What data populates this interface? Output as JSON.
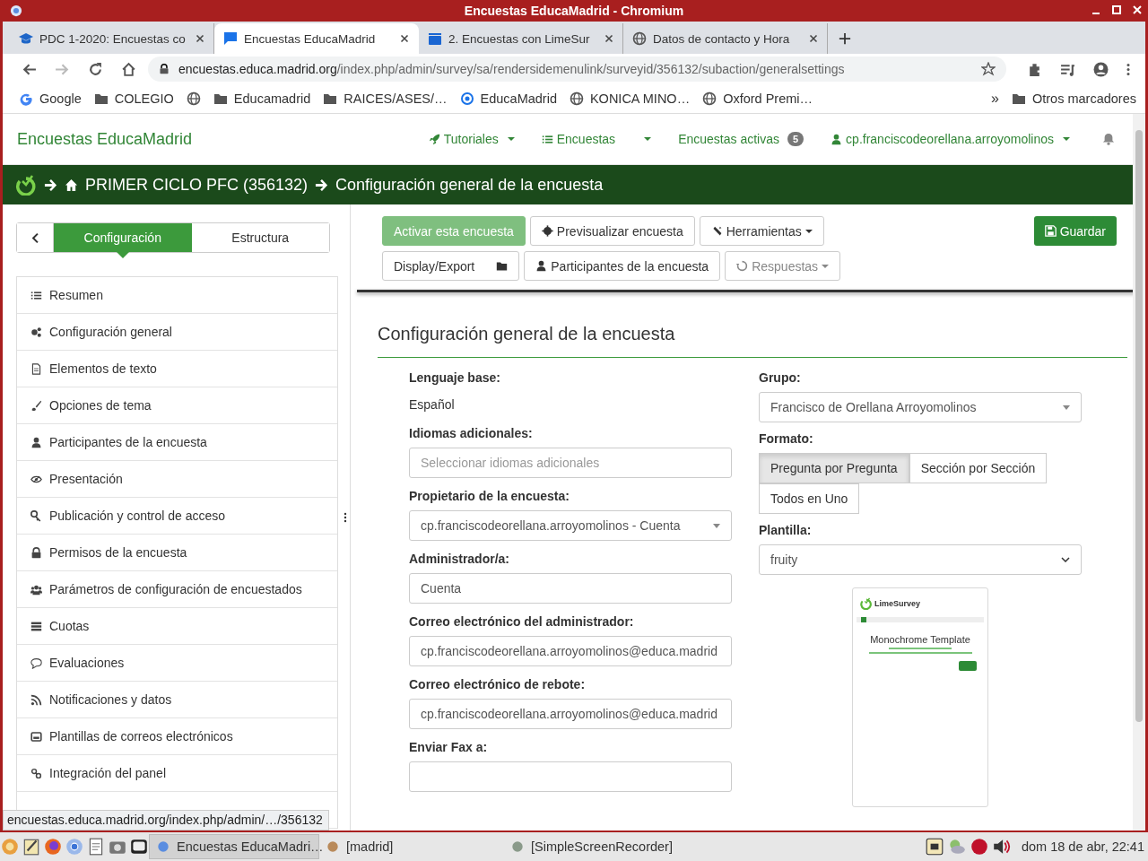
{
  "window": {
    "title": "Encuestas EducaMadrid - Chromium"
  },
  "tabs": [
    {
      "title": "PDC 1-2020: Encuestas co",
      "selected": false
    },
    {
      "title": "Encuestas EducaMadrid",
      "selected": true
    },
    {
      "title": "2. Encuestas con LimeSur",
      "selected": false
    },
    {
      "title": "Datos de contacto y Hora",
      "selected": false
    }
  ],
  "address": {
    "host": "encuestas.educa.madrid.org",
    "path": "/index.php/admin/survey/sa/rendersidemenulink/surveyid/356132/subaction/generalsettings"
  },
  "bookmarks": [
    "Google",
    "COLEGIO",
    "Educamadrid",
    "RAICES/ASES/…",
    "EducaMadrid",
    "KONICA MINO…",
    "Oxford Premi…"
  ],
  "bookmarks_overflow": "»",
  "other_bookmarks": "Otros marcadores",
  "app": {
    "brand": "Encuestas EducaMadrid",
    "nav": [
      {
        "label": "Tutoriales",
        "kind": "dropdown"
      },
      {
        "label": "Encuestas",
        "kind": "split"
      },
      {
        "label": "Encuestas activas",
        "kind": "badge",
        "badge": "5"
      },
      {
        "label": "cp.franciscodeorellana.arroyomolinos",
        "kind": "dropdown"
      }
    ],
    "breadcrumb": [
      "PRIMER CICLO PFC (356132)",
      "Configuración general de la encuesta"
    ]
  },
  "sidebar": {
    "tabs": [
      {
        "label": "Configuración",
        "selected": true
      },
      {
        "label": "Estructura",
        "selected": false
      }
    ],
    "items": [
      "Resumen",
      "Configuración general",
      "Elementos de texto",
      "Opciones de tema",
      "Participantes de la encuesta",
      "Presentación",
      "Publicación y control de acceso",
      "Permisos de la encuesta",
      "Parámetros de configuración de encuestados",
      "Cuotas",
      "Evaluaciones",
      "Notificaciones y datos",
      "Plantillas de correos electrónicos",
      "Integración del panel"
    ]
  },
  "toolbar": [
    [
      {
        "label": "Activar esta encuesta",
        "kind": "success"
      },
      {
        "label": "Previsualizar encuesta",
        "kind": "default"
      },
      {
        "label": "Herramientas",
        "kind": "dropdown"
      }
    ],
    [
      {
        "label": "Display/Export",
        "kind": "default"
      },
      {
        "label": "Participantes de la encuesta",
        "kind": "default"
      },
      {
        "label": "Respuestas",
        "kind": "muted-dropdown"
      }
    ]
  ],
  "save": {
    "label": "Guardar"
  },
  "section_title": "Configuración general de la encuesta",
  "left_fields": [
    {
      "label": "Lenguaje base:",
      "kind": "text",
      "value": "Español"
    },
    {
      "label": "Idiomas adicionales:",
      "kind": "input",
      "placeholder": "Seleccionar idiomas adicionales"
    },
    {
      "label": "Propietario de la encuesta:",
      "kind": "select",
      "value": "cp.franciscodeorellana.arroyomolinos - Cuenta"
    },
    {
      "label": "Administrador/a:",
      "kind": "input",
      "value": "Cuenta"
    },
    {
      "label": "Correo electrónico del administrador:",
      "kind": "input",
      "value": "cp.franciscodeorellana.arroyomolinos@educa.madrid"
    },
    {
      "label": "Correo electrónico de rebote:",
      "kind": "input",
      "value": "cp.franciscodeorellana.arroyomolinos@educa.madrid"
    },
    {
      "label": "Enviar Fax a:",
      "kind": "input"
    }
  ],
  "group": {
    "label": "Grupo:",
    "value": "Francisco de Orellana Arroyomolinos"
  },
  "format": {
    "label": "Formato:",
    "options": [
      {
        "label": "Pregunta por Pregunta",
        "selected": true
      },
      {
        "label": "Sección por Sección",
        "selected": false
      },
      {
        "label": "Todos en Uno",
        "selected": false
      }
    ]
  },
  "template": {
    "label": "Plantilla:",
    "value": "fruity",
    "preview": {
      "logo": "LimeSurvey",
      "title": "Monochrome Template"
    }
  },
  "status_url": "encuestas.educa.madrid.org/index.php/admin/…/356132",
  "taskbar": {
    "tasks": [
      {
        "label": "Encuestas EducaMadri…",
        "selected": true
      },
      {
        "label": "[madrid]",
        "selected": false
      },
      {
        "label": "[SimpleScreenRecorder]",
        "selected": false
      }
    ],
    "clock": "dom 18 de abr, 22:41"
  }
}
